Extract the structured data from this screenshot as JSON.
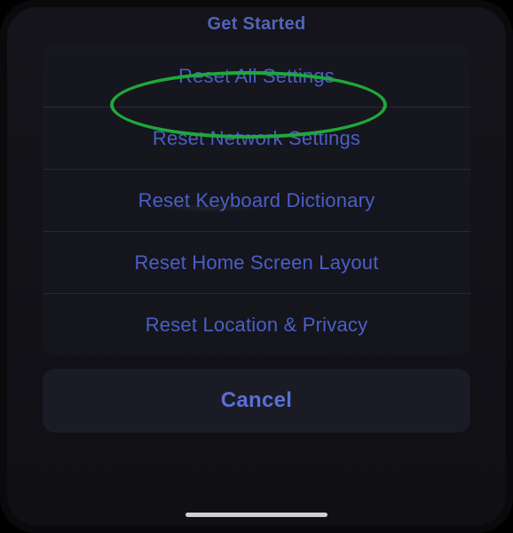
{
  "header": {
    "title": "Get Started"
  },
  "actionSheet": {
    "options": [
      {
        "label": "Reset All Settings"
      },
      {
        "label": "Reset Network Settings"
      },
      {
        "label": "Reset Keyboard Dictionary"
      },
      {
        "label": "Reset Home Screen Layout"
      },
      {
        "label": "Reset Location & Privacy"
      }
    ],
    "cancel": "Cancel"
  },
  "annotation": {
    "highlight_color": "#1fa83a",
    "highlighted_option_index": 0
  }
}
